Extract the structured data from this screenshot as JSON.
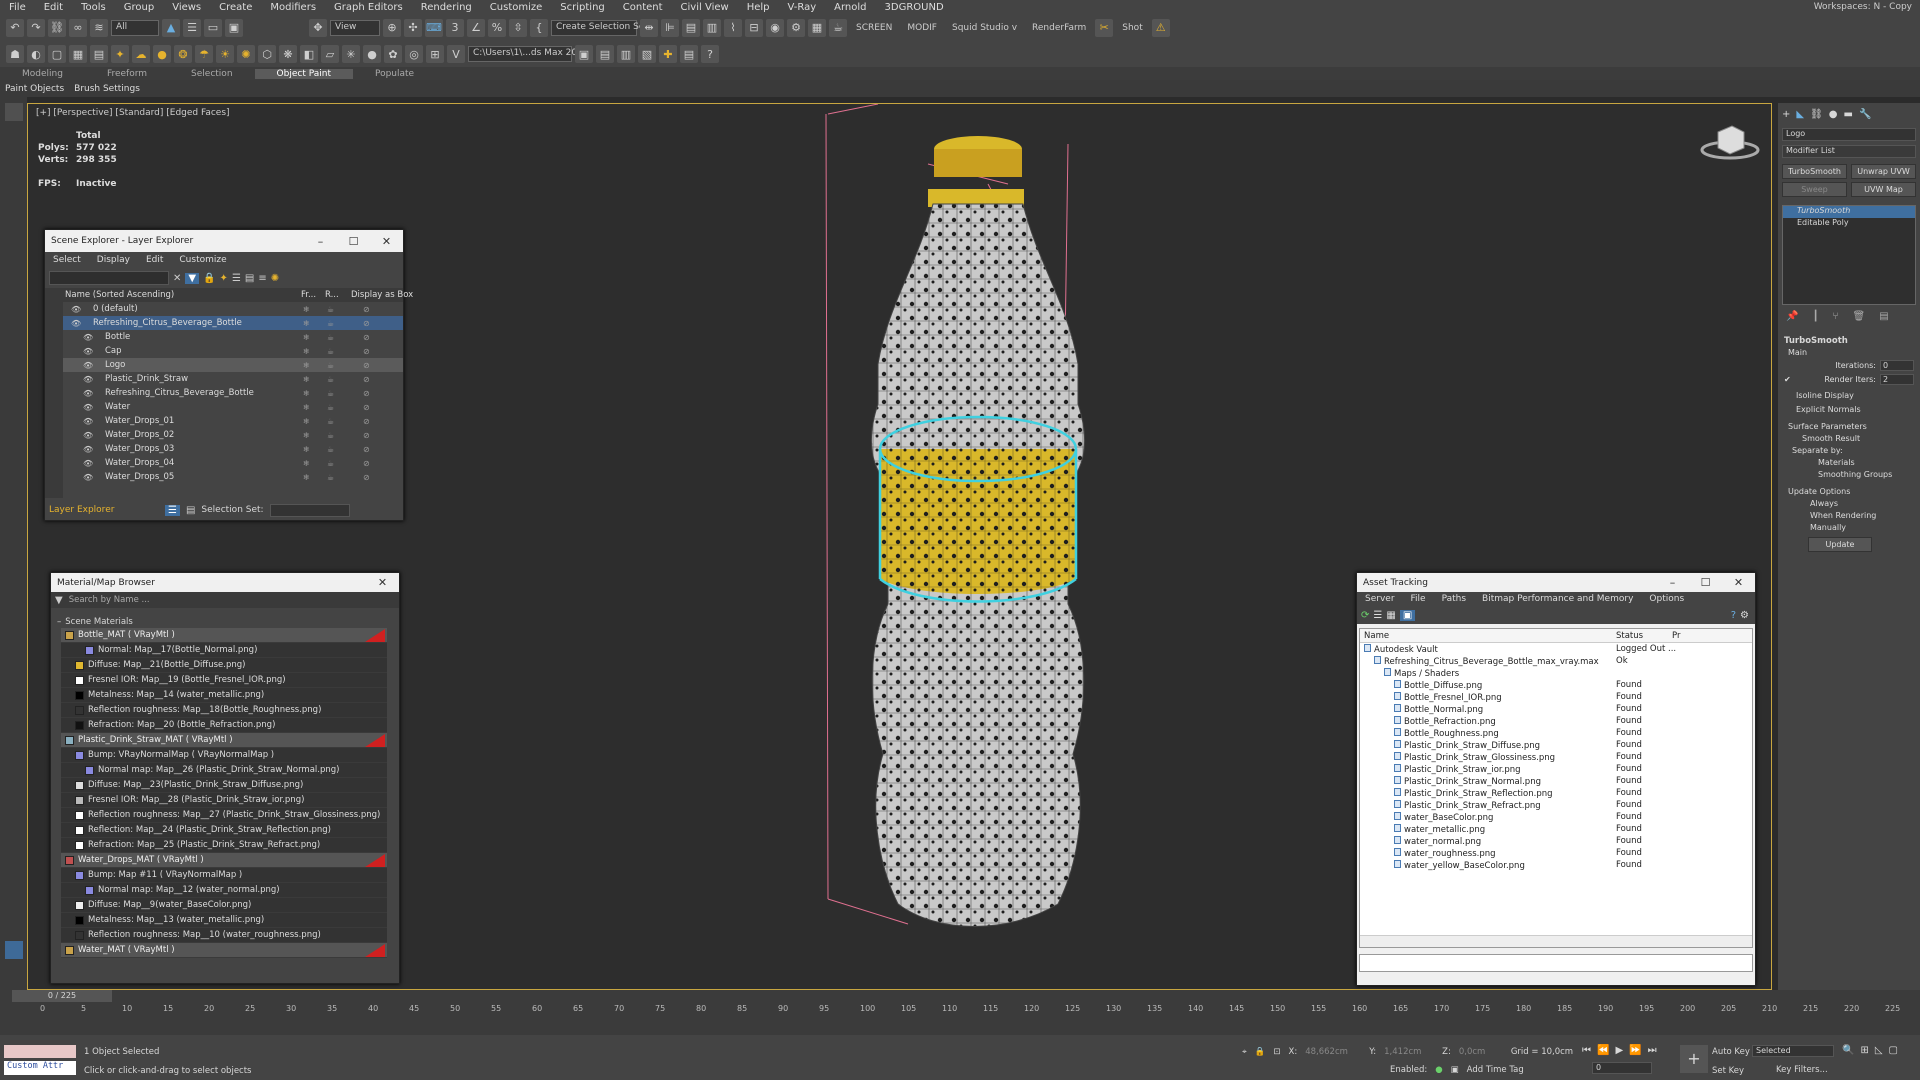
{
  "menubar": {
    "items": [
      "File",
      "Edit",
      "Tools",
      "Group",
      "Views",
      "Create",
      "Modifiers",
      "Graph Editors",
      "Rendering",
      "Customize",
      "Scripting",
      "Content",
      "Civil View",
      "Help",
      "V-Ray",
      "Arnold",
      "3DGROUND"
    ],
    "workspaces": "Workspaces: N - Copy"
  },
  "toolbar": {
    "filter": "All",
    "refcoord": "View",
    "selection_set": "Create Selection Se",
    "screen": "SCREEN",
    "modif": "MODIF",
    "squid": "Squid Studio v",
    "renderfarm": "RenderFarm",
    "shot": "Shot",
    "path": "C:\\Users\\1\\...ds Max 202..."
  },
  "ribbon": {
    "tabs": [
      "Modeling",
      "Freeform",
      "Selection",
      "Object Paint",
      "Populate"
    ],
    "active": "Object Paint",
    "sub": [
      "Paint Objects",
      "Brush Settings"
    ]
  },
  "viewport": {
    "label": "[+] [Perspective] [Standard] [Edged Faces]",
    "total": "Total",
    "polys_label": "Polys:",
    "polys": "577 022",
    "verts_label": "Verts:",
    "verts": "298 355",
    "fps_label": "FPS:",
    "fps": "Inactive"
  },
  "scene_explorer": {
    "title": "Scene Explorer - Layer Explorer",
    "menus": [
      "Select",
      "Display",
      "Edit",
      "Customize"
    ],
    "col_name": "Name (Sorted Ascending)",
    "col_fr": "Fr...",
    "col_r": "R...",
    "col_box": "Display as Box",
    "rows": [
      {
        "name": "0 (default)",
        "indent": 0
      },
      {
        "name": "Refreshing_Citrus_Beverage_Bottle",
        "indent": 0
      },
      {
        "name": "Bottle",
        "indent": 1
      },
      {
        "name": "Cap",
        "indent": 1
      },
      {
        "name": "Logo",
        "indent": 1
      },
      {
        "name": "Plastic_Drink_Straw",
        "indent": 1
      },
      {
        "name": "Refreshing_Citrus_Beverage_Bottle",
        "indent": 1
      },
      {
        "name": "Water",
        "indent": 1
      },
      {
        "name": "Water_Drops_01",
        "indent": 1
      },
      {
        "name": "Water_Drops_02",
        "indent": 1
      },
      {
        "name": "Water_Drops_03",
        "indent": 1
      },
      {
        "name": "Water_Drops_04",
        "indent": 1
      },
      {
        "name": "Water_Drops_05",
        "indent": 1
      }
    ],
    "footer_mode": "Layer Explorer",
    "footer_selset": "Selection Set:"
  },
  "material_browser": {
    "title": "Material/Map Browser",
    "search_placeholder": "Search by Name ...",
    "group": "Scene Materials",
    "rows": [
      {
        "text": "Bottle_MAT  ( VRayMtl )",
        "type": "mat",
        "color": "#c9a24a",
        "indent": 0
      },
      {
        "text": "Normal: Map__17(Bottle_Normal.png)",
        "type": "map",
        "color": "#8a8ae0",
        "indent": 2
      },
      {
        "text": "Diffuse: Map__21(Bottle_Diffuse.png)",
        "type": "map",
        "color": "#e0b830",
        "indent": 1
      },
      {
        "text": "Fresnel IOR: Map__19 (Bottle_Fresnel_IOR.png)",
        "type": "map",
        "color": "#ffffff",
        "indent": 1
      },
      {
        "text": "Metalness: Map__14 (water_metallic.png)",
        "type": "map",
        "color": "#000000",
        "indent": 1
      },
      {
        "text": "Reflection roughness: Map__18(Bottle_Roughness.png)",
        "type": "map",
        "color": "#333333",
        "indent": 1
      },
      {
        "text": "Refraction: Map__20 (Bottle_Refraction.png)",
        "type": "map",
        "color": "#111111",
        "indent": 1
      },
      {
        "text": "Plastic_Drink_Straw_MAT  ( VRayMtl )",
        "type": "mat",
        "color": "#8ab0c0",
        "indent": 0
      },
      {
        "text": "Bump: VRayNormalMap  ( VRayNormalMap )",
        "type": "map",
        "color": "#8a8ae0",
        "indent": 1
      },
      {
        "text": "Normal map: Map__26 (Plastic_Drink_Straw_Normal.png)",
        "type": "map",
        "color": "#8a8ae0",
        "indent": 2
      },
      {
        "text": "Diffuse: Map__23(Plastic_Drink_Straw_Diffuse.png)",
        "type": "map",
        "color": "#dddddd",
        "indent": 1
      },
      {
        "text": "Fresnel IOR: Map__28 (Plastic_Drink_Straw_ior.png)",
        "type": "map",
        "color": "#bbbbbb",
        "indent": 1
      },
      {
        "text": "Reflection roughness: Map__27 (Plastic_Drink_Straw_Glossiness.png)",
        "type": "map",
        "color": "#ffffff",
        "indent": 1
      },
      {
        "text": "Reflection: Map__24 (Plastic_Drink_Straw_Reflection.png)",
        "type": "map",
        "color": "#ffffff",
        "indent": 1
      },
      {
        "text": "Refraction: Map__25 (Plastic_Drink_Straw_Refract.png)",
        "type": "map",
        "color": "#ffffff",
        "indent": 1
      },
      {
        "text": "Water_Drops_MAT  ( VRayMtl )",
        "type": "mat",
        "color": "#c05050",
        "indent": 0
      },
      {
        "text": "Bump: Map #11  ( VRayNormalMap )",
        "type": "map",
        "color": "#8a8ae0",
        "indent": 1
      },
      {
        "text": "Normal map: Map__12 (water_normal.png)",
        "type": "map",
        "color": "#8a8ae0",
        "indent": 2
      },
      {
        "text": "Diffuse: Map__9(water_BaseColor.png)",
        "type": "map",
        "color": "#eeeeee",
        "indent": 1
      },
      {
        "text": "Metalness: Map__13 (water_metallic.png)",
        "type": "map",
        "color": "#000000",
        "indent": 1
      },
      {
        "text": "Reflection roughness: Map__10 (water_roughness.png)",
        "type": "map",
        "color": "#333333",
        "indent": 1
      },
      {
        "text": "Water_MAT  ( VRayMtl )",
        "type": "mat",
        "color": "#c9a24a",
        "indent": 0
      }
    ]
  },
  "asset_tracking": {
    "title": "Asset Tracking",
    "menus": [
      "Server",
      "File",
      "Paths",
      "Bitmap Performance and Memory",
      "Options"
    ],
    "col_name": "Name",
    "col_status": "Status",
    "col_pr": "Pr",
    "rows": [
      {
        "name": "Autodesk Vault",
        "status": "Logged Out ...",
        "indent": 0
      },
      {
        "name": "Refreshing_Citrus_Beverage_Bottle_max_vray.max",
        "status": "Ok",
        "indent": 1
      },
      {
        "name": "Maps / Shaders",
        "status": "",
        "indent": 2
      },
      {
        "name": "Bottle_Diffuse.png",
        "status": "Found",
        "indent": 3
      },
      {
        "name": "Bottle_Fresnel_IOR.png",
        "status": "Found",
        "indent": 3
      },
      {
        "name": "Bottle_Normal.png",
        "status": "Found",
        "indent": 3
      },
      {
        "name": "Bottle_Refraction.png",
        "status": "Found",
        "indent": 3
      },
      {
        "name": "Bottle_Roughness.png",
        "status": "Found",
        "indent": 3
      },
      {
        "name": "Plastic_Drink_Straw_Diffuse.png",
        "status": "Found",
        "indent": 3
      },
      {
        "name": "Plastic_Drink_Straw_Glossiness.png",
        "status": "Found",
        "indent": 3
      },
      {
        "name": "Plastic_Drink_Straw_ior.png",
        "status": "Found",
        "indent": 3
      },
      {
        "name": "Plastic_Drink_Straw_Normal.png",
        "status": "Found",
        "indent": 3
      },
      {
        "name": "Plastic_Drink_Straw_Reflection.png",
        "status": "Found",
        "indent": 3
      },
      {
        "name": "Plastic_Drink_Straw_Refract.png",
        "status": "Found",
        "indent": 3
      },
      {
        "name": "water_BaseColor.png",
        "status": "Found",
        "indent": 3
      },
      {
        "name": "water_metallic.png",
        "status": "Found",
        "indent": 3
      },
      {
        "name": "water_normal.png",
        "status": "Found",
        "indent": 3
      },
      {
        "name": "water_roughness.png",
        "status": "Found",
        "indent": 3
      },
      {
        "name": "water_yellow_BaseColor.png",
        "status": "Found",
        "indent": 3
      }
    ]
  },
  "command_panel": {
    "object_name": "Logo",
    "modifier_list": "Modifier List",
    "btn_turbosmooth": "TurboSmooth",
    "btn_unwrap": "Unwrap UVW",
    "btn_sweep": "Sweep",
    "btn_uvwmap": "UVW Map",
    "stack": [
      "TurboSmooth",
      "Editable Poly"
    ],
    "rollout": "TurboSmooth",
    "main": "Main",
    "iterations_label": "Iterations:",
    "iterations": "0",
    "render_iters_label": "Render Iters:",
    "render_iters": "2",
    "isoline": "Isoline Display",
    "explicit": "Explicit Normals",
    "surface_params": "Surface Parameters",
    "smooth_result": "Smooth Result",
    "separate_by": "Separate by:",
    "materials": "Materials",
    "smoothing_groups": "Smoothing Groups",
    "update_options": "Update Options",
    "always": "Always",
    "when_rendering": "When Rendering",
    "manually": "Manually",
    "update": "Update"
  },
  "timeline": {
    "frame": "0 / 225",
    "ticks": [
      "0",
      "5",
      "10",
      "15",
      "20",
      "25",
      "30",
      "35",
      "40",
      "45",
      "50",
      "55",
      "60",
      "65",
      "70",
      "75",
      "80",
      "85",
      "90",
      "95",
      "100",
      "105",
      "110",
      "115",
      "120",
      "125",
      "130",
      "135",
      "140",
      "145",
      "150",
      "155",
      "160",
      "165",
      "170",
      "175",
      "180",
      "185",
      "190",
      "195",
      "200",
      "205",
      "210",
      "215",
      "220",
      "225"
    ]
  },
  "statusbar": {
    "maxscript": "Custom Attr",
    "selected": "1 Object Selected",
    "prompt": "Click or click-and-drag to select objects",
    "x_label": "X:",
    "x": "48,662cm",
    "y_label": "Y:",
    "y": "1,412cm",
    "z_label": "Z:",
    "z": "0,0cm",
    "grid": "Grid = 10,0cm",
    "enabled": "Enabled:",
    "add_time_tag": "Add Time Tag",
    "auto_key": "Auto Key",
    "set_key": "Set Key",
    "selected_dd": "Selected",
    "key_filters": "Key Filters...",
    "frame_field": "0"
  },
  "colors": {
    "accent": "#c8a640",
    "selection": "#3f5f88",
    "label_yellow": "#d9b82a"
  }
}
